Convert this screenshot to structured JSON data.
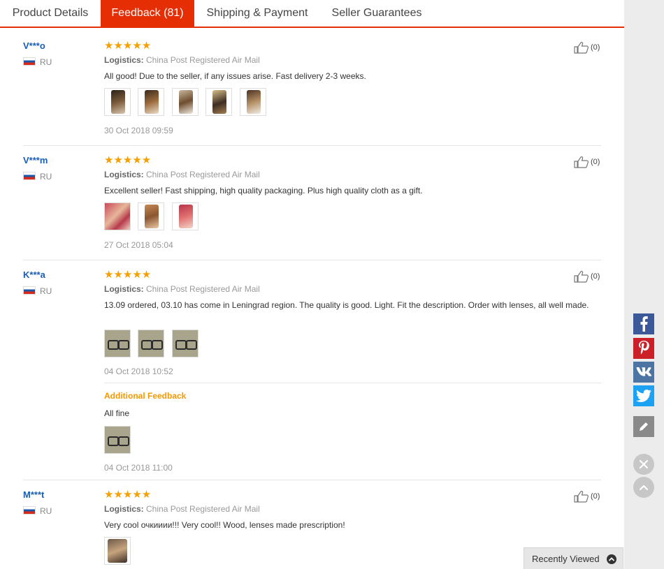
{
  "tabs": [
    {
      "label": "Product Details"
    },
    {
      "label": "Feedback (81)"
    },
    {
      "label": "Shipping & Payment"
    },
    {
      "label": "Seller Guarantees"
    }
  ],
  "logistics_label": "Logistics:",
  "reviews": [
    {
      "name": "V***o",
      "country": "RU",
      "stars": "★★★★★",
      "logistics": "China Post Registered Air Mail",
      "text": "All good! Due to the seller, if any issues arise. Fast delivery 2-3 weeks.",
      "date": "30 Oct 2018 09:59",
      "helpful": "(0)"
    },
    {
      "name": "V***m",
      "country": "RU",
      "stars": "★★★★★",
      "logistics": "China Post Registered Air Mail",
      "text": "Excellent seller! Fast shipping, high quality packaging. Plus high quality cloth as a gift.",
      "date": "27 Oct 2018 05:04",
      "helpful": "(0)"
    },
    {
      "name": "K***a",
      "country": "RU",
      "stars": "★★★★★",
      "logistics": "China Post Registered Air Mail",
      "text": "13.09 ordered, 03.10 has come in Leningrad region. The quality is good. Light. Fit the description. Order with lenses, all well made.",
      "date": "04 Oct 2018 10:52",
      "helpful": "(0)",
      "additional": {
        "title": "Additional Feedback",
        "text": "All fine",
        "date": "04 Oct 2018 11:00"
      }
    },
    {
      "name": "M***t",
      "country": "RU",
      "stars": "★★★★★",
      "logistics": "China Post Registered Air Mail",
      "text": "Very cool очкииии!!! Very cool!! Wood, lenses made prescription!",
      "helpful": "(0)"
    }
  ],
  "recently_viewed": "Recently Viewed",
  "colors": {
    "accent": "#e62e04",
    "link": "#1a5eb4",
    "stars": "#f5a000",
    "facebook": "#3b5998",
    "pinterest": "#cb2027",
    "vk": "#4c75a3",
    "twitter": "#1da1f2"
  }
}
